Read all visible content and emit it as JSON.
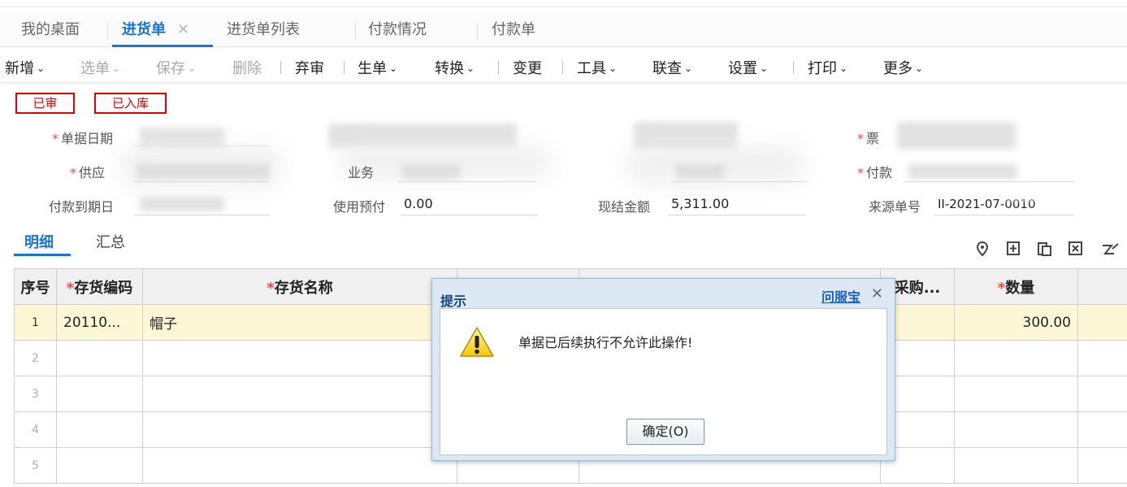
{
  "tabs": [
    {
      "label": "我的桌面"
    },
    {
      "label": "进货单",
      "close": "✕"
    },
    {
      "label": "进货单列表"
    },
    {
      "label": "付款情况"
    },
    {
      "label": "付款单"
    }
  ],
  "toolbar": {
    "new": "新增",
    "select": "选单",
    "save": "保存",
    "delete": "删除",
    "unaudit": "弃审",
    "generate": "生单",
    "convert": "转换",
    "change": "变更",
    "tools": "工具",
    "query": "联查",
    "settings": "设置",
    "print": "打印",
    "more": "更多",
    "chev": "⌄"
  },
  "status": {
    "audited": "已审",
    "stocked": "已入库"
  },
  "form": {
    "required_mark": "*",
    "doc_date_label": "单据日期",
    "supplier_label": "供应",
    "business_label": "业务",
    "bill_label": "票",
    "pay_label": "付款",
    "due_date_label": "付款到期日",
    "prepay_label": "使用预付",
    "prepay_value": "0.00",
    "settle_label": "现结金额",
    "settle_value": "5,311.00",
    "source_label": "来源单号",
    "source_value": "II-2021-07-0010"
  },
  "subtabs": {
    "detail": "明细",
    "summary": "汇总"
  },
  "grid": {
    "headers": {
      "seq": "序号",
      "code": "存货编码",
      "name": "存货名称",
      "purchase": "采购...",
      "qty": "数量"
    },
    "rows": [
      {
        "seq": "1",
        "code": "20110...",
        "name": "帽子",
        "qty": "300.00"
      },
      {
        "seq": "2",
        "code": "",
        "name": "",
        "qty": ""
      },
      {
        "seq": "3",
        "code": "",
        "name": "",
        "qty": ""
      },
      {
        "seq": "4",
        "code": "",
        "name": "",
        "qty": ""
      },
      {
        "seq": "5",
        "code": "",
        "name": "",
        "qty": ""
      }
    ]
  },
  "dialog": {
    "title": "提示",
    "help": "问服宝",
    "close": "✕",
    "message": "单据已后续执行不允许此操作!",
    "ok": "确定(O)"
  },
  "colors": {
    "accent": "#1a74d8",
    "status_red": "#e60000",
    "selected_row": "#fdf7d6"
  }
}
